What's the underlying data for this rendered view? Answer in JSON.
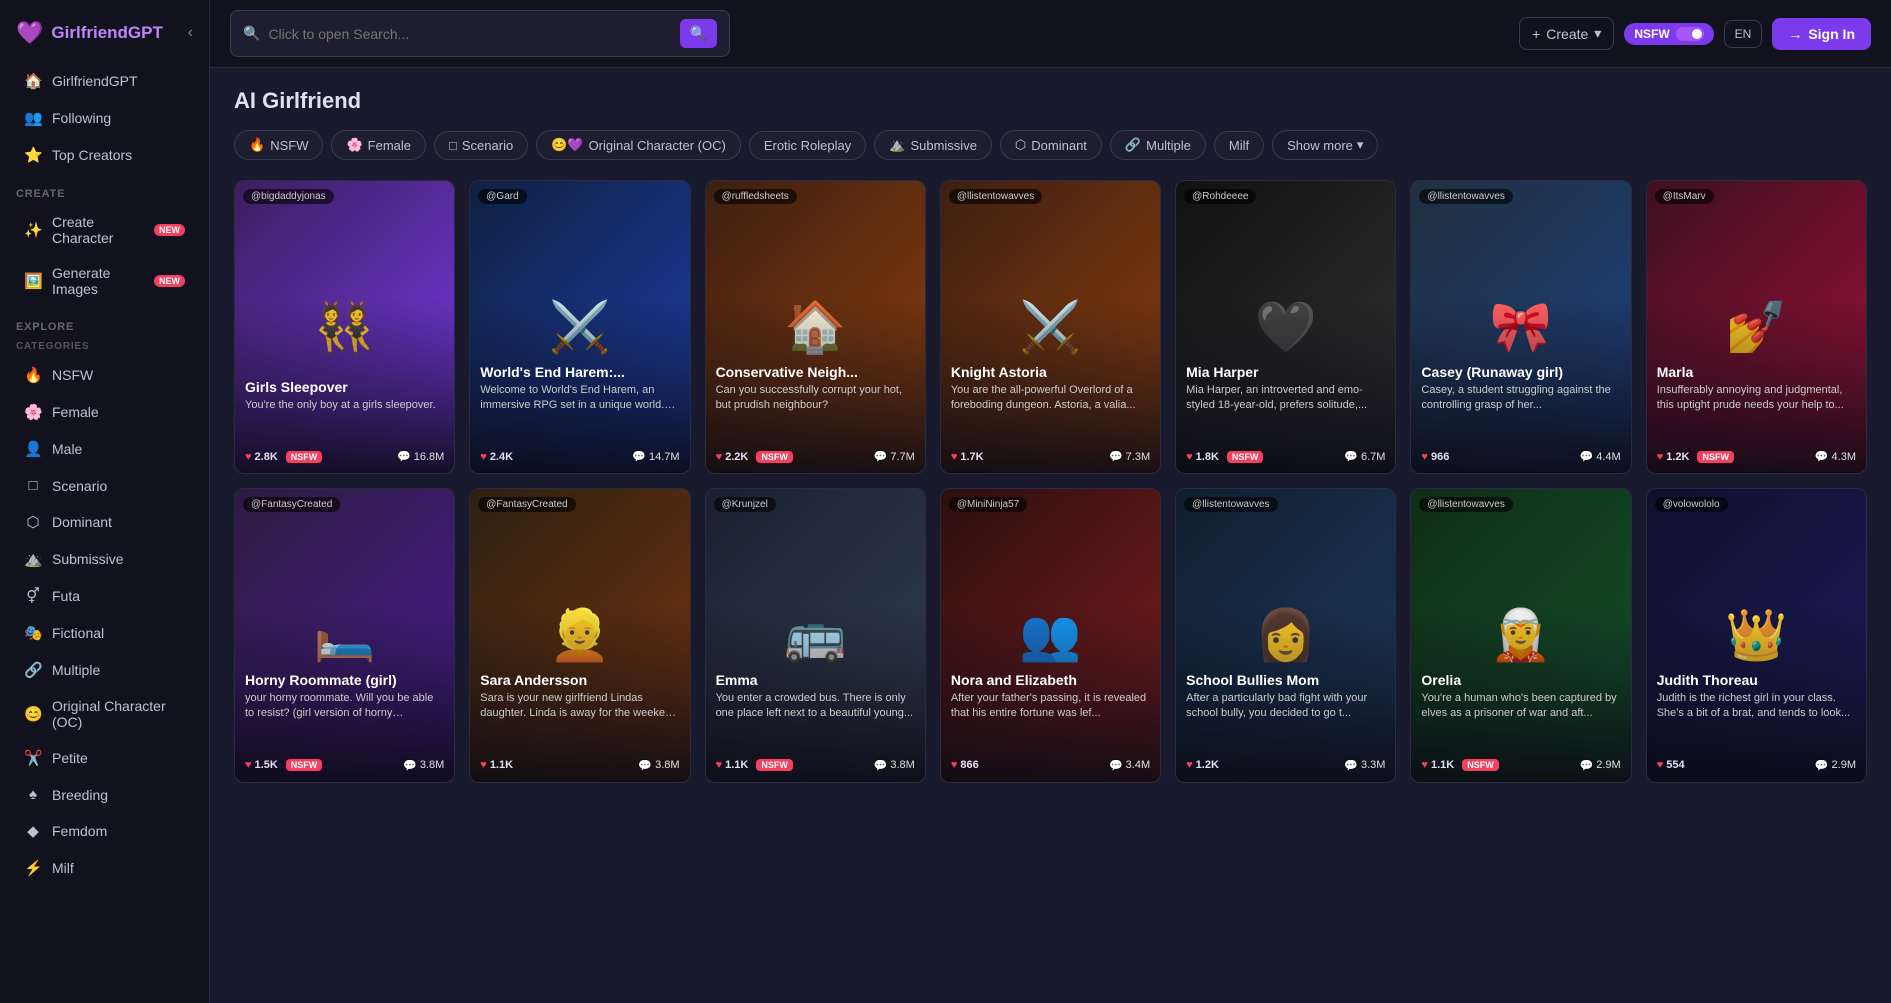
{
  "app": {
    "name": "GirlfriendGPT",
    "logo_icon": "💜"
  },
  "sidebar": {
    "nav_items": [
      {
        "id": "girlfriendgpt",
        "icon": "🏠",
        "label": "GirlfriendGPT"
      },
      {
        "id": "following",
        "icon": "👥",
        "label": "Following"
      },
      {
        "id": "top-creators",
        "icon": "⭐",
        "label": "Top Creators"
      }
    ],
    "create_section": "Create",
    "create_items": [
      {
        "id": "create-character",
        "icon": "✨",
        "label": "Create Character",
        "badge": "NEW"
      },
      {
        "id": "generate-images",
        "icon": "🖼️",
        "label": "Generate Images",
        "badge": "NEW"
      }
    ],
    "explore_section": "Explore",
    "categories_label": "Categories",
    "category_items": [
      {
        "id": "nsfw",
        "icon": "🔥",
        "label": "NSFW"
      },
      {
        "id": "female",
        "icon": "🌸",
        "label": "Female"
      },
      {
        "id": "male",
        "icon": "👤",
        "label": "Male"
      },
      {
        "id": "scenario",
        "icon": "□",
        "label": "Scenario"
      },
      {
        "id": "dominant",
        "icon": "⬡",
        "label": "Dominant"
      },
      {
        "id": "submissive",
        "icon": "⛰️",
        "label": "Submissive"
      },
      {
        "id": "futa",
        "icon": "⚥",
        "label": "Futa"
      },
      {
        "id": "fictional",
        "icon": "🎭",
        "label": "Fictional"
      },
      {
        "id": "multiple",
        "icon": "🔗",
        "label": "Multiple"
      },
      {
        "id": "oc",
        "icon": "😊",
        "label": "Original Character (OC)"
      },
      {
        "id": "petite",
        "icon": "✂️",
        "label": "Petite"
      },
      {
        "id": "breeding",
        "icon": "♠",
        "label": "Breeding"
      },
      {
        "id": "femdom",
        "icon": "◆",
        "label": "Femdom"
      },
      {
        "id": "milf",
        "icon": "⚡",
        "label": "Milf"
      }
    ]
  },
  "header": {
    "search_placeholder": "Click to open Search...",
    "create_label": "Create",
    "nsfw_label": "NSFW",
    "translate_label": "EN",
    "signin_label": "Sign In"
  },
  "main": {
    "page_title": "AI Girlfriend",
    "filters": [
      {
        "id": "nsfw",
        "icon": "🔥",
        "label": "NSFW"
      },
      {
        "id": "female",
        "icon": "🌸",
        "label": "Female"
      },
      {
        "id": "scenario",
        "icon": "□",
        "label": "Scenario"
      },
      {
        "id": "oc",
        "icon": "😊💜",
        "label": "Original Character (OC)"
      },
      {
        "id": "erotic-roleplay",
        "icon": "",
        "label": "Erotic Roleplay"
      },
      {
        "id": "submissive",
        "icon": "⛰️",
        "label": "Submissive"
      },
      {
        "id": "dominant",
        "icon": "⬡",
        "label": "Dominant"
      },
      {
        "id": "multiple",
        "icon": "🔗",
        "label": "Multiple"
      },
      {
        "id": "milf",
        "icon": "",
        "label": "Milf"
      }
    ],
    "show_more_label": "Show more",
    "cards_row1": [
      {
        "id": "girls-sleepover",
        "creator": "@bigdaddyjonas",
        "name": "Girls Sleepover",
        "desc": "You're the only boy at a girls sleepover.",
        "likes": "2.8K",
        "chats": "16.8M",
        "nsfw": true,
        "bg": "bg-purple",
        "emoji": "👯"
      },
      {
        "id": "worlds-end-harem",
        "creator": "@Gard",
        "name": "World's End Harem:...",
        "desc": "Welcome to World's End Harem, an immersive RPG set in a unique world. As...",
        "likes": "2.4K",
        "chats": "14.7M",
        "nsfw": false,
        "bg": "bg-dark-blue",
        "emoji": "⚔️"
      },
      {
        "id": "conservative-neighbor",
        "creator": "@ruffledsheets",
        "name": "Conservative Neigh...",
        "desc": "Can you successfully corrupt your hot, but prudish neighbour?",
        "likes": "2.2K",
        "chats": "7.7M",
        "nsfw": true,
        "bg": "bg-warm",
        "emoji": "🏠"
      },
      {
        "id": "knight-astoria",
        "creator": "@llistentowavves",
        "name": "Knight Astoria",
        "desc": "You are the all-powerful Overlord of a foreboding dungeon. Astoria, a valia...",
        "likes": "1.7K",
        "chats": "7.3M",
        "nsfw": false,
        "bg": "bg-warm",
        "emoji": "⚔️"
      },
      {
        "id": "mia-harper",
        "creator": "@Rohdeeee",
        "name": "Mia Harper",
        "desc": "Mia Harper, an introverted and emo-styled 18-year-old, prefers solitude,...",
        "likes": "1.8K",
        "chats": "6.7M",
        "nsfw": true,
        "bg": "bg-dark",
        "emoji": "🖤"
      },
      {
        "id": "casey-runaway",
        "creator": "@llistentowavves",
        "name": "Casey (Runaway girl)",
        "desc": "Casey, a student struggling against the controlling grasp of her...",
        "likes": "966",
        "chats": "4.4M",
        "nsfw": false,
        "bg": "bg-school",
        "emoji": "🎀"
      },
      {
        "id": "marla",
        "creator": "@ItsMarv",
        "name": "Marla",
        "desc": "Insufferably annoying and judgmental, this uptight prude needs your help to...",
        "likes": "1.2K",
        "chats": "4.3M",
        "nsfw": true,
        "bg": "bg-maroon",
        "emoji": "💅"
      }
    ],
    "cards_row2": [
      {
        "id": "horny-roommate",
        "creator": "@FantasyCreated",
        "name": "Horny Roommate (girl)",
        "desc": "your horny roommate. Will you be able to resist? (girl version of horny roomma...",
        "likes": "1.5K",
        "chats": "3.8M",
        "nsfw": true,
        "bg": "bg-bedroom",
        "emoji": "🛏️"
      },
      {
        "id": "sara-andersson",
        "creator": "@FantasyCreated",
        "name": "Sara Andersson",
        "desc": "Sara is your new girlfriend Lindas daughter. Linda is away for the weekend an...",
        "likes": "1.1K",
        "chats": "3.8M",
        "nsfw": false,
        "bg": "bg-blonde",
        "emoji": "👱"
      },
      {
        "id": "emma",
        "creator": "@Krunjzel",
        "name": "Emma",
        "desc": "You enter a crowded bus. There is only one place left next to a beautiful young...",
        "likes": "1.1K",
        "chats": "3.8M",
        "nsfw": true,
        "bg": "bg-bus",
        "emoji": "🚌"
      },
      {
        "id": "nora-elizabeth",
        "creator": "@MiniNinja57",
        "name": "Nora and Elizabeth",
        "desc": "After your father's passing, it is revealed that his entire fortune was lef...",
        "likes": "866",
        "chats": "3.4M",
        "nsfw": false,
        "bg": "bg-redhead",
        "emoji": "👥"
      },
      {
        "id": "school-bullies-mom",
        "creator": "@llistentowavves",
        "name": "School Bullies Mom",
        "desc": "After a particularly bad fight with your school bully, you decided to go t...",
        "likes": "1.2K",
        "chats": "3.3M",
        "nsfw": false,
        "bg": "bg-school2",
        "emoji": "👩"
      },
      {
        "id": "orelia",
        "creator": "@llistentowavves",
        "name": "Orelia",
        "desc": "You're a human who's been captured by elves as a prisoner of war and aft...",
        "likes": "1.1K",
        "chats": "2.9M",
        "nsfw": true,
        "bg": "bg-elf",
        "emoji": "🧝"
      },
      {
        "id": "judith-thoreau",
        "creator": "@volowololo",
        "name": "Judith Thoreau",
        "desc": "Judith is the richest girl in your class. She's a bit of a brat, and tends to look...",
        "likes": "554",
        "chats": "2.9M",
        "nsfw": false,
        "bg": "bg-anime",
        "emoji": "👑"
      }
    ]
  }
}
